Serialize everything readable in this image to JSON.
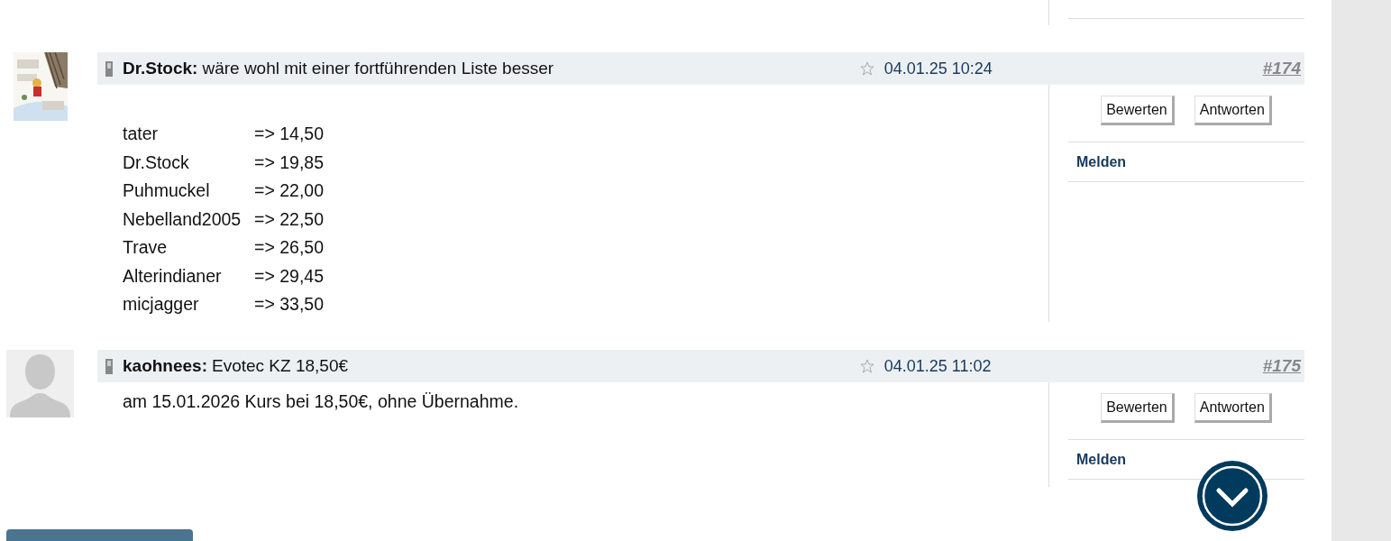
{
  "posts": [
    {
      "author": "Dr.Stock:",
      "title": "wäre wohl mit einer fortführenden Liste besser",
      "starred": false,
      "date": "04.01.25 10:24",
      "number": "#174",
      "body": {
        "kind": "list",
        "rows": [
          {
            "name": "tater",
            "value": "=> 14,50"
          },
          {
            "name": "Dr.Stock",
            "value": "=> 19,85"
          },
          {
            "name": "Puhmuckel",
            "value": "=> 22,00"
          },
          {
            "name": "Nebelland2005",
            "value": "=> 22,50"
          },
          {
            "name": "Trave",
            "value": "=> 26,50"
          },
          {
            "name": "Alterindianer",
            "value": "=> 29,45"
          },
          {
            "name": "micjagger",
            "value": "=> 33,50"
          }
        ]
      },
      "buttons": [
        "Bewerten",
        "Antworten"
      ],
      "report_link": "Melden"
    },
    {
      "avatar": {
        "kind": "placeholder"
      },
      "author": "kaohnees:",
      "title": "Evotec KZ 18,50€",
      "starred": false,
      "date": "04.01.25 11:02",
      "number": "#175",
      "body": {
        "kind": "text",
        "text": "am 15.01.2026 Kurs bei 18,50€, ohne Übernahme."
      },
      "buttons": [
        "Bewerten",
        "Antworten"
      ],
      "report_link": "Melden"
    }
  ]
}
